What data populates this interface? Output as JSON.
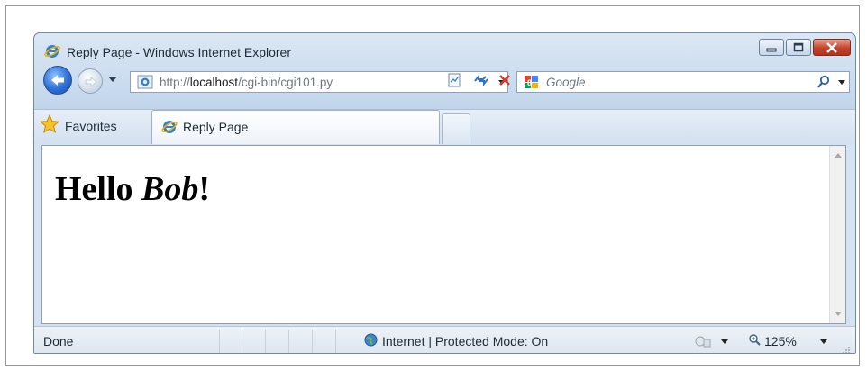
{
  "window": {
    "title": "Reply Page - Windows Internet Explorer",
    "icon": "ie-logo-icon"
  },
  "controls": {
    "minimize_icon": "minimize-icon",
    "maximize_icon": "maximize-icon",
    "close_icon": "close-icon"
  },
  "nav": {
    "back_icon": "back-arrow-icon",
    "forward_icon": "forward-arrow-icon",
    "recent_pages_icon": "chevron-down-icon"
  },
  "address": {
    "prefix": "http://",
    "host": "localhost",
    "path": "/cgi-bin/cgi101.py"
  },
  "search": {
    "placeholder": "Google"
  },
  "favorites": {
    "label": "Favorites"
  },
  "tabs": [
    {
      "label": "Reply Page",
      "active": true
    }
  ],
  "page": {
    "heading_prefix": "Hello ",
    "heading_name": "Bob",
    "heading_suffix": "!"
  },
  "status": {
    "text": "Done",
    "zone": "Internet | Protected Mode: On",
    "zoom": "125%"
  },
  "colors": {
    "chrome": "#c9dbee",
    "close_button": "#c4432b",
    "back_button": "#2e6fd6"
  }
}
